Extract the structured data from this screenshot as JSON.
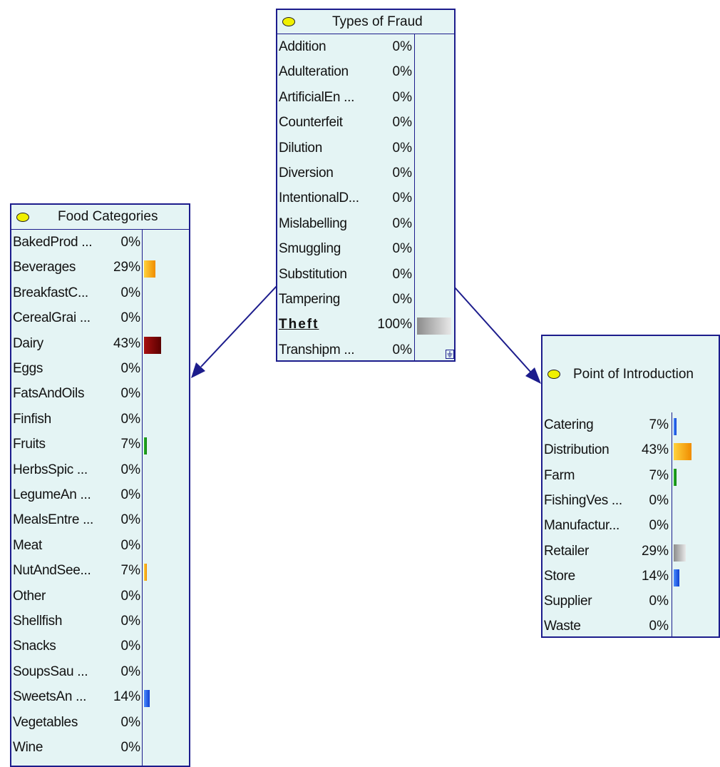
{
  "nodes": {
    "fraud": {
      "title": "Types of Fraud",
      "states": [
        {
          "label": "Addition",
          "pct": "0%",
          "value": 0
        },
        {
          "label": "Adulteration",
          "pct": "0%",
          "value": 0
        },
        {
          "label": "ArtificialEn ...",
          "pct": "0%",
          "value": 0
        },
        {
          "label": "Counterfeit",
          "pct": "0%",
          "value": 0
        },
        {
          "label": "Dilution",
          "pct": "0%",
          "value": 0
        },
        {
          "label": "Diversion",
          "pct": "0%",
          "value": 0
        },
        {
          "label": "IntentionalD...",
          "pct": "0%",
          "value": 0
        },
        {
          "label": "Mislabelling",
          "pct": "0%",
          "value": 0
        },
        {
          "label": "Smuggling",
          "pct": "0%",
          "value": 0
        },
        {
          "label": "Substitution",
          "pct": "0%",
          "value": 0
        },
        {
          "label": "Tampering",
          "pct": "0%",
          "value": 0
        },
        {
          "label": "Theft",
          "pct": "100%",
          "value": 100,
          "color": "gray",
          "selected": true
        },
        {
          "label": "Transhipm ...",
          "pct": "0%",
          "value": 0
        }
      ]
    },
    "food": {
      "title": "Food Categories",
      "states": [
        {
          "label": "BakedProd ...",
          "pct": "0%",
          "value": 0
        },
        {
          "label": "Beverages",
          "pct": "29%",
          "value": 29,
          "color": "orange"
        },
        {
          "label": "BreakfastC...",
          "pct": "0%",
          "value": 0
        },
        {
          "label": "CerealGrai ...",
          "pct": "0%",
          "value": 0
        },
        {
          "label": "Dairy",
          "pct": "43%",
          "value": 43,
          "color": "darkred"
        },
        {
          "label": "Eggs",
          "pct": "0%",
          "value": 0
        },
        {
          "label": "FatsAndOils",
          "pct": "0%",
          "value": 0
        },
        {
          "label": "Finfish",
          "pct": "0%",
          "value": 0
        },
        {
          "label": "Fruits",
          "pct": "7%",
          "value": 7,
          "color": "green"
        },
        {
          "label": "HerbsSpic ...",
          "pct": "0%",
          "value": 0
        },
        {
          "label": "LegumeAn ...",
          "pct": "0%",
          "value": 0
        },
        {
          "label": "MealsEntre ...",
          "pct": "0%",
          "value": 0
        },
        {
          "label": "Meat",
          "pct": "0%",
          "value": 0
        },
        {
          "label": "NutAndSee...",
          "pct": "7%",
          "value": 7,
          "color": "orange"
        },
        {
          "label": "Other",
          "pct": "0%",
          "value": 0
        },
        {
          "label": "Shellfish",
          "pct": "0%",
          "value": 0
        },
        {
          "label": "Snacks",
          "pct": "0%",
          "value": 0
        },
        {
          "label": "SoupsSau ...",
          "pct": "0%",
          "value": 0
        },
        {
          "label": "SweetsAn ...",
          "pct": "14%",
          "value": 14,
          "color": "blue"
        },
        {
          "label": "Vegetables",
          "pct": "0%",
          "value": 0
        },
        {
          "label": "Wine",
          "pct": "0%",
          "value": 0
        }
      ]
    },
    "point": {
      "title": "Point of Introduction",
      "states": [
        {
          "label": "Catering",
          "pct": "7%",
          "value": 7,
          "color": "blue"
        },
        {
          "label": "Distribution",
          "pct": "43%",
          "value": 43,
          "color": "orange"
        },
        {
          "label": "Farm",
          "pct": "7%",
          "value": 7,
          "color": "green"
        },
        {
          "label": "FishingVes ...",
          "pct": "0%",
          "value": 0
        },
        {
          "label": "Manufactur...",
          "pct": "0%",
          "value": 0
        },
        {
          "label": "Retailer",
          "pct": "29%",
          "value": 29,
          "color": "gray"
        },
        {
          "label": "Store",
          "pct": "14%",
          "value": 14,
          "color": "blue"
        },
        {
          "label": "Supplier",
          "pct": "0%",
          "value": 0
        },
        {
          "label": "Waste",
          "pct": "0%",
          "value": 0
        }
      ]
    }
  },
  "palette": {
    "orange": [
      "#ffd23c",
      "#f08c00"
    ],
    "darkred": [
      "#a81010",
      "#5a0000"
    ],
    "green": [
      "#28b428",
      "#108010"
    ],
    "blue": [
      "#4a8cff",
      "#1040d0"
    ],
    "gray": [
      "#e8e8e8",
      "#8c8c8c"
    ],
    "edge": "#1c1c8c",
    "node_bg": "#e4f4f4",
    "node_border": "#1c1c8c",
    "oval": "#f0f000"
  }
}
